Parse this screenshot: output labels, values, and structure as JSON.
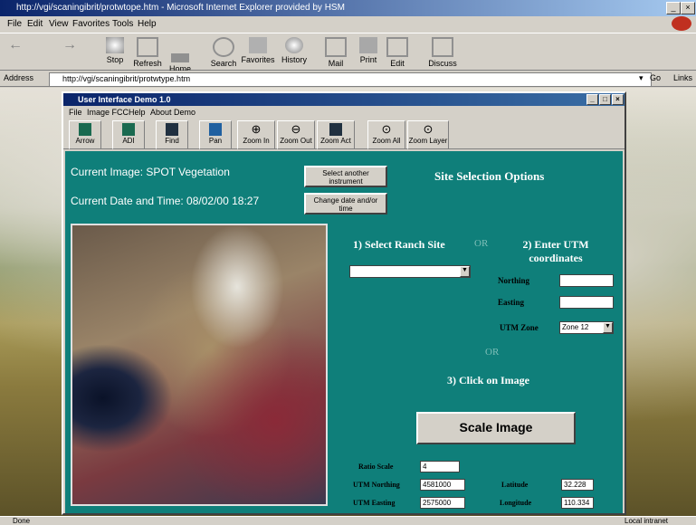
{
  "browser": {
    "title": "http://vgi/scaningibrit/protwtope.htm - Microsoft Internet Explorer provided by HSM",
    "menu": [
      "File",
      "Edit",
      "View",
      "Favorites",
      "Tools",
      "Help"
    ],
    "toolbar": [
      "Stop",
      "Refresh",
      "Home",
      "Search",
      "Favorites",
      "History",
      "Mail",
      "Print",
      "Edit",
      "Discuss"
    ],
    "address_label": "Address",
    "address_value": "http://vgi/scaningibrit/protwtype.htm",
    "go_label": "Go",
    "links_label": "Links",
    "status_left": "Done",
    "status_right": "Local intranet"
  },
  "app": {
    "title": "User Interface Demo 1.0",
    "menu": [
      "File",
      "Image FCC",
      "Help",
      "About Demo"
    ],
    "toolbar": [
      "Arrow",
      "ADI",
      "Find",
      "Pan",
      "Zoom In",
      "Zoom Out",
      "Zoom Act",
      "Zoom All",
      "Zoom Layer"
    ],
    "current_image_label": "Current Image: SPOT Vegetation",
    "current_datetime_label": "Current Date and Time: 08/02/00 18:27",
    "select_instrument_button": "Select another instrument",
    "change_datetime_button": "Change date and/or time",
    "site_options_title": "Site Selection Options",
    "option1": "1) Select Ranch Site",
    "or1": "OR",
    "option2": "2) Enter UTM coordinates",
    "northing_label": "Northing",
    "easting_label": "Easting",
    "utm_zone_label": "UTM Zone",
    "utm_zone_value": "Zone 12",
    "or2": "OR",
    "option3": "3) Click on Image",
    "scale_button": "Scale Image",
    "ratio_scale_label": "Ratio Scale",
    "ratio_scale_value": "4",
    "utm_northing_label": "UTM Northing",
    "utm_northing_value": "4581000",
    "utm_easting_label": "UTM Easting",
    "utm_easting_value": "2575000",
    "latitude_label": "Latitude",
    "latitude_value": "32.228",
    "longitude_label": "Longitude",
    "longitude_value": "110.334"
  }
}
